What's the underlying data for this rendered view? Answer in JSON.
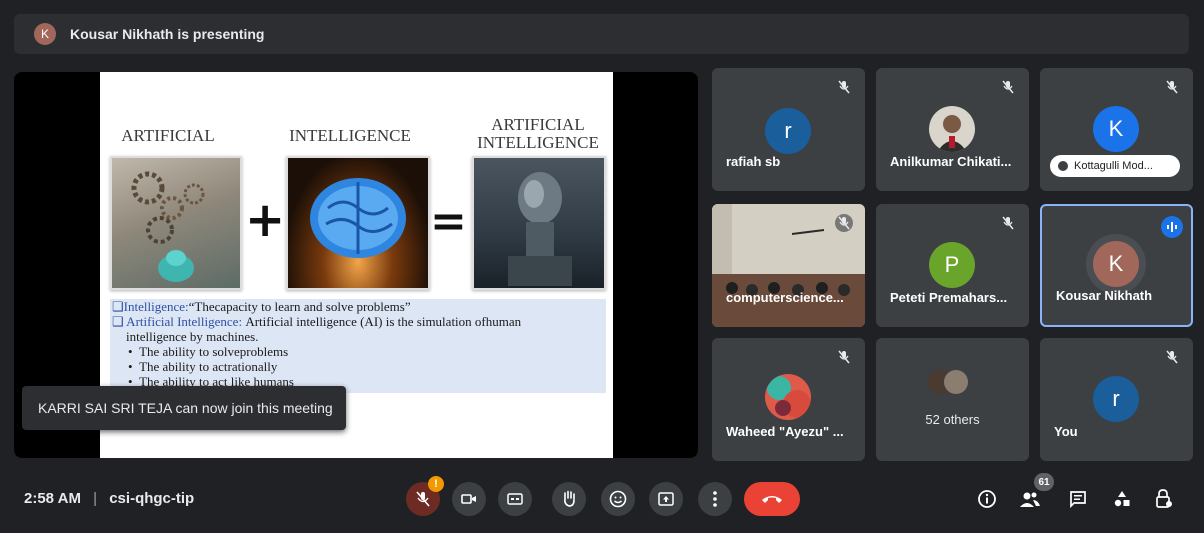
{
  "header": {
    "avatar_letter": "K",
    "presenting_text": "Kousar Nikhath is presenting"
  },
  "slide": {
    "heading_artificial": "ARTIFICIAL",
    "heading_intelligence": "INTELLIGENCE",
    "heading_ai_line1": "ARTIFICIAL",
    "heading_ai_line2": "INTELLIGENCE",
    "plus": "+",
    "equals": "=",
    "line1_label": "❑Intelligence:",
    "line1_text": "“Thecapacity to learn and solve problems”",
    "line2_label": "❑ Artificial Intelligence:",
    "line2_text": "Artificial intelligence (AI) is the simulation ofhuman",
    "line3_text": "intelligence by machines.",
    "bullet1": "The ability to solveproblems",
    "bullet2": "The ability to actrationally",
    "bullet3": "The ability to act like humans"
  },
  "toast": {
    "text": "KARRI SAI SRI TEJA can now join this meeting"
  },
  "participants": [
    {
      "name": "rafiah sb",
      "avatar": "r",
      "color": "#1a5e9c"
    },
    {
      "name": "Anilkumar Chikati...",
      "avatar": "",
      "color": ""
    },
    {
      "name": "Kottagulli Mod...",
      "avatar": "K",
      "color": "#1a73e8"
    },
    {
      "name": "computerscience...",
      "avatar": "",
      "color": ""
    },
    {
      "name": "Peteti Premahars...",
      "avatar": "P",
      "color": "#6aa52b"
    },
    {
      "name": "Kousar Nikhath",
      "avatar": "K",
      "color": "#a0675a"
    },
    {
      "name": "Waheed \"Ayezu\" ...",
      "avatar": "",
      "color": ""
    },
    {
      "name": "52 others",
      "avatar": "",
      "color": ""
    },
    {
      "name": "You",
      "avatar": "r",
      "color": "#1a5e9c"
    }
  ],
  "bottom": {
    "time": "2:58 AM",
    "separator": "|",
    "meeting_code": "csi-qhgc-tip",
    "mic_alert": "!",
    "participants_count": "61",
    "end_call_color": "#ea4335"
  }
}
